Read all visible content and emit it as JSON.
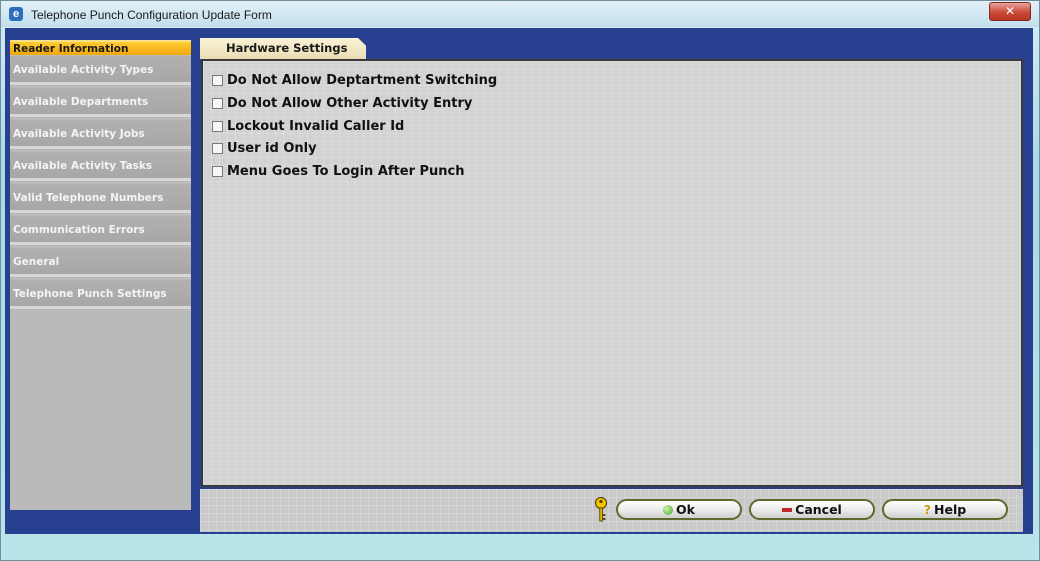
{
  "window": {
    "title": "Telephone Punch Configuration Update Form",
    "app_icon_glyph": "e",
    "close_glyph": "✕"
  },
  "sidebar": {
    "items": [
      {
        "label": "Reader Information",
        "active": true
      },
      {
        "label": "Available Activity Types",
        "active": false
      },
      {
        "label": "Available Departments",
        "active": false
      },
      {
        "label": "Available Activity Jobs",
        "active": false
      },
      {
        "label": "Available Activity Tasks",
        "active": false
      },
      {
        "label": "Valid Telephone Numbers",
        "active": false
      },
      {
        "label": "Communication Errors",
        "active": false
      },
      {
        "label": "General",
        "active": false
      },
      {
        "label": "Telephone Punch Settings",
        "active": false
      }
    ]
  },
  "tab": {
    "label": "Hardware Settings"
  },
  "settings": {
    "checkboxes": [
      {
        "label": "Do Not Allow Deptartment Switching",
        "checked": false
      },
      {
        "label": "Do Not Allow Other Activity Entry",
        "checked": false
      },
      {
        "label": "Lockout Invalid Caller Id",
        "checked": false
      },
      {
        "label": "User id Only",
        "checked": false
      },
      {
        "label": "Menu Goes To Login After Punch",
        "checked": false
      }
    ]
  },
  "footer": {
    "ok_label": "Ok",
    "cancel_label": "Cancel",
    "help_label": "Help",
    "help_icon_glyph": "?"
  },
  "colors": {
    "accent_blue": "#27408f",
    "active_tab": "#f0a80c",
    "button_border": "#5d6b2a"
  }
}
